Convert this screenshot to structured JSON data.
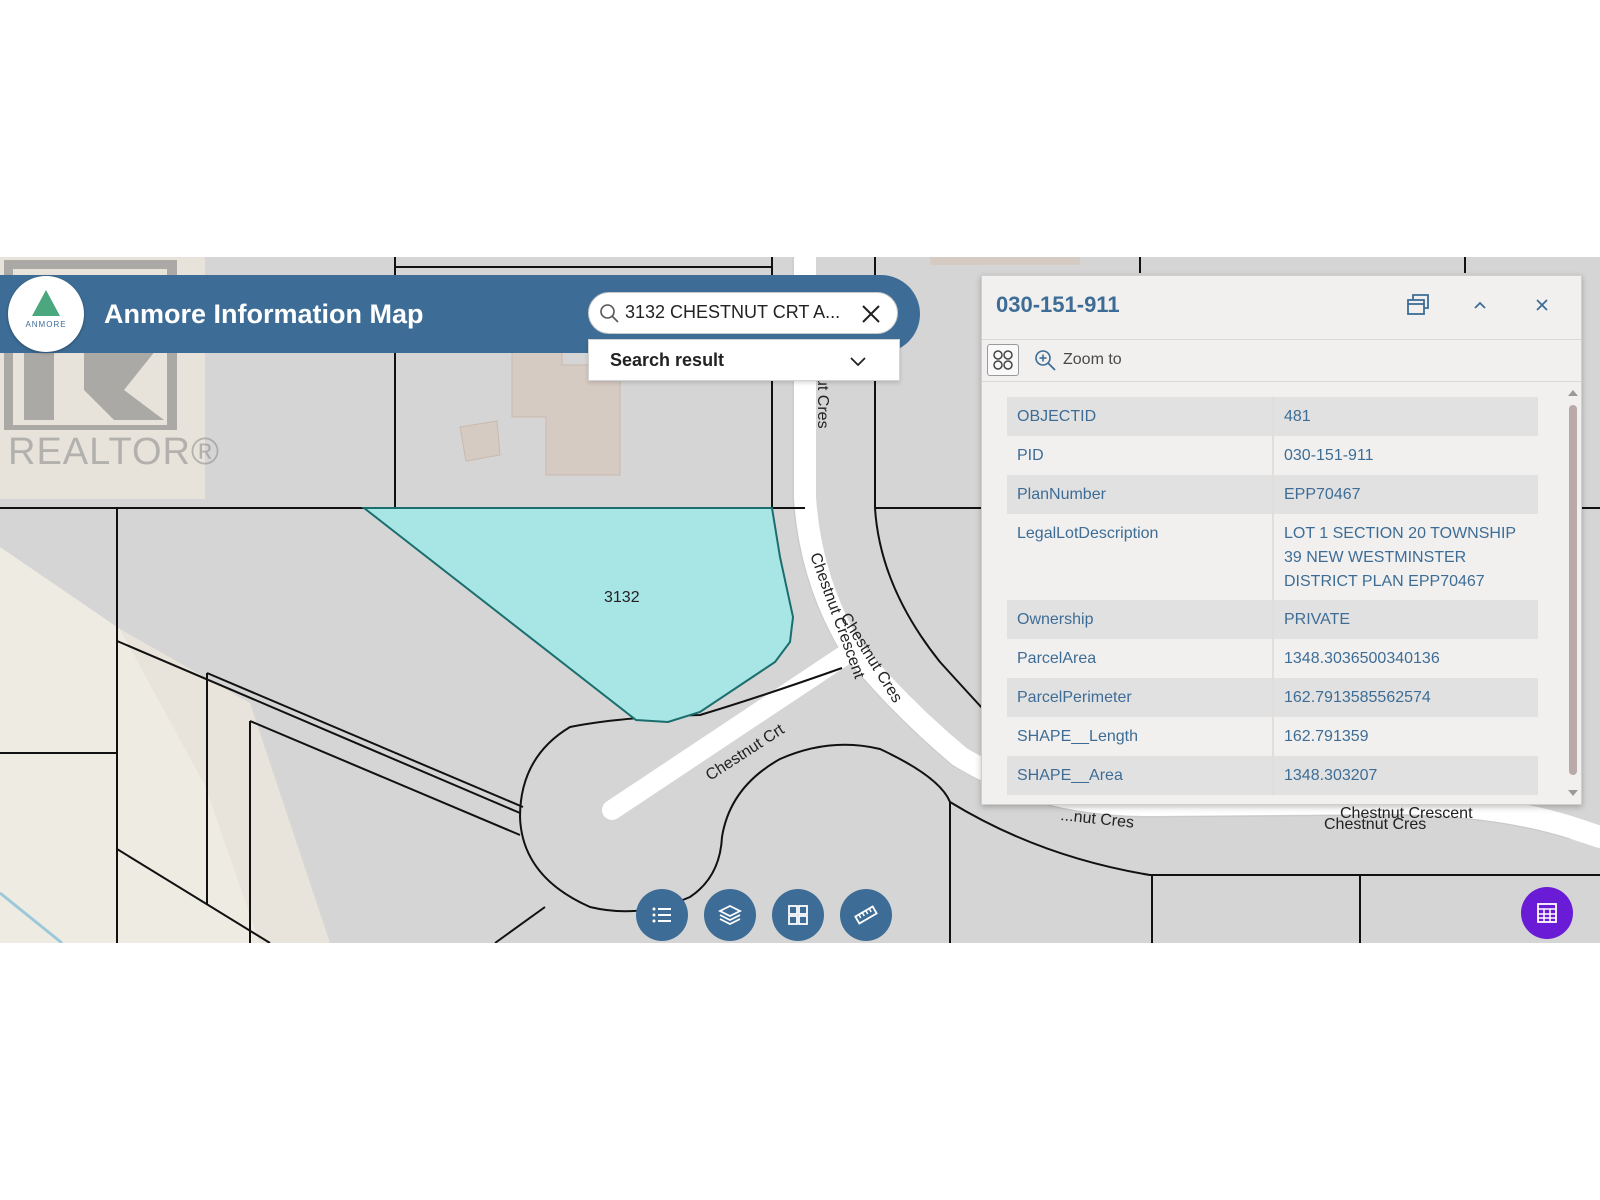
{
  "header": {
    "title": "Anmore Information Map",
    "logo_text": "ANMORE"
  },
  "search": {
    "value": "3132 CHESTNUT CRT A...",
    "result_label": "Search result"
  },
  "watermark": {
    "text": "REALTOR®"
  },
  "map": {
    "parcel_label": "3132",
    "street_labels": {
      "chestnut_cres_top": "ut Cres",
      "chestnut_crescent_diag": "Chestnut Crescent",
      "chestnut_cres_diag": "Chestnut Cres",
      "chestnut_crt": "Chestnut Crt",
      "chestnut_cres_bottom_left": "...nut Cres",
      "chestnut_crescent_bottom": "Chestnut Crescent",
      "chestnut_cres_bottom": "Chestnut Cres"
    },
    "colors": {
      "background": "#d6d5d5",
      "parcel_fill": "#a8e5e5",
      "parcel_stroke": "#1a6e6e",
      "road": "#ffffff",
      "green_area": "#eeebe3",
      "building": "#d6cbc3"
    }
  },
  "popup": {
    "title": "030-151-911",
    "zoom_label": "Zoom to",
    "attributes": [
      {
        "key": "OBJECTID",
        "value": "481"
      },
      {
        "key": "PID",
        "value": "030-151-911"
      },
      {
        "key": "PlanNumber",
        "value": "EPP70467"
      },
      {
        "key": "LegalLotDescription",
        "value": "LOT 1 SECTION 20 TOWNSHIP 39 NEW WESTMINSTER DISTRICT PLAN EPP70467"
      },
      {
        "key": "Ownership",
        "value": "PRIVATE"
      },
      {
        "key": "ParcelArea",
        "value": "1348.3036500340136"
      },
      {
        "key": "ParcelPerimeter",
        "value": "162.7913585562574"
      },
      {
        "key": "SHAPE__Length",
        "value": "162.791359"
      },
      {
        "key": "SHAPE__Area",
        "value": "1348.303207"
      }
    ]
  },
  "toolbar": {
    "buttons": [
      "list-icon",
      "layers-icon",
      "basemap-grid-icon",
      "measure-ruler-icon",
      "table-icon"
    ],
    "table_button_color": "#6a1bd6",
    "button_color": "#3d6d96"
  }
}
